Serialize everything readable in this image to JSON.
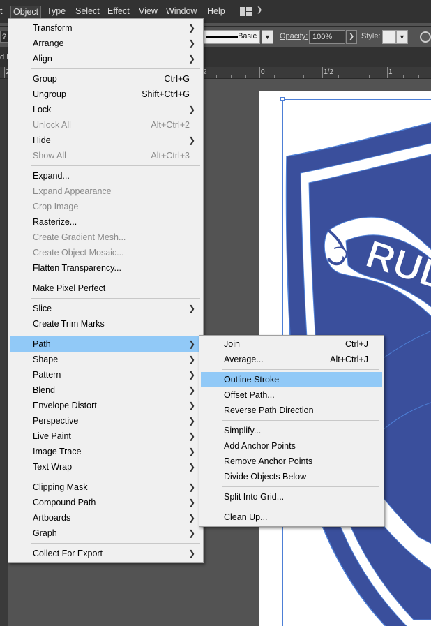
{
  "menubar": {
    "items": [
      {
        "label": "t",
        "active": false
      },
      {
        "label": "Object",
        "active": true
      },
      {
        "label": "Type",
        "active": false
      },
      {
        "label": "Select",
        "active": false
      },
      {
        "label": "Effect",
        "active": false
      },
      {
        "label": "View",
        "active": false
      },
      {
        "label": "Window",
        "active": false
      },
      {
        "label": "Help",
        "active": false
      }
    ],
    "workspace_icon": "workspace-layout-icon"
  },
  "controlbar": {
    "left_glyph": "?",
    "stroke_profile": "Basic",
    "opacity_label": "Opacity:",
    "opacity_value": "100%",
    "style_label": "Style:"
  },
  "tabstrip": {
    "fragment": "d I"
  },
  "ruler": {
    "labels": [
      "2",
      "2",
      "0",
      "1/2",
      "1"
    ]
  },
  "object_menu": {
    "items": [
      {
        "label": "Transform",
        "shortcut": "",
        "submenu": true,
        "disabled": false
      },
      {
        "label": "Arrange",
        "shortcut": "",
        "submenu": true,
        "disabled": false
      },
      {
        "label": "Align",
        "shortcut": "",
        "submenu": true,
        "disabled": false
      },
      {
        "label": "Group",
        "shortcut": "Ctrl+G",
        "submenu": false,
        "disabled": false
      },
      {
        "label": "Ungroup",
        "shortcut": "Shift+Ctrl+G",
        "submenu": false,
        "disabled": false
      },
      {
        "label": "Lock",
        "shortcut": "",
        "submenu": true,
        "disabled": false
      },
      {
        "label": "Unlock All",
        "shortcut": "Alt+Ctrl+2",
        "submenu": false,
        "disabled": true
      },
      {
        "label": "Hide",
        "shortcut": "",
        "submenu": true,
        "disabled": false
      },
      {
        "label": "Show All",
        "shortcut": "Alt+Ctrl+3",
        "submenu": false,
        "disabled": true
      },
      {
        "label": "Expand...",
        "shortcut": "",
        "submenu": false,
        "disabled": false
      },
      {
        "label": "Expand Appearance",
        "shortcut": "",
        "submenu": false,
        "disabled": true
      },
      {
        "label": "Crop Image",
        "shortcut": "",
        "submenu": false,
        "disabled": true
      },
      {
        "label": "Rasterize...",
        "shortcut": "",
        "submenu": false,
        "disabled": false
      },
      {
        "label": "Create Gradient Mesh...",
        "shortcut": "",
        "submenu": false,
        "disabled": true
      },
      {
        "label": "Create Object Mosaic...",
        "shortcut": "",
        "submenu": false,
        "disabled": true
      },
      {
        "label": "Flatten Transparency...",
        "shortcut": "",
        "submenu": false,
        "disabled": false
      },
      {
        "label": "Make Pixel Perfect",
        "shortcut": "",
        "submenu": false,
        "disabled": false
      },
      {
        "label": "Slice",
        "shortcut": "",
        "submenu": true,
        "disabled": false
      },
      {
        "label": "Create Trim Marks",
        "shortcut": "",
        "submenu": false,
        "disabled": false
      },
      {
        "label": "Path",
        "shortcut": "",
        "submenu": true,
        "disabled": false,
        "highlighted": true
      },
      {
        "label": "Shape",
        "shortcut": "",
        "submenu": true,
        "disabled": false
      },
      {
        "label": "Pattern",
        "shortcut": "",
        "submenu": true,
        "disabled": false
      },
      {
        "label": "Blend",
        "shortcut": "",
        "submenu": true,
        "disabled": false
      },
      {
        "label": "Envelope Distort",
        "shortcut": "",
        "submenu": true,
        "disabled": false
      },
      {
        "label": "Perspective",
        "shortcut": "",
        "submenu": true,
        "disabled": false
      },
      {
        "label": "Live Paint",
        "shortcut": "",
        "submenu": true,
        "disabled": false
      },
      {
        "label": "Image Trace",
        "shortcut": "",
        "submenu": true,
        "disabled": false
      },
      {
        "label": "Text Wrap",
        "shortcut": "",
        "submenu": true,
        "disabled": false
      },
      {
        "label": "Clipping Mask",
        "shortcut": "",
        "submenu": true,
        "disabled": false
      },
      {
        "label": "Compound Path",
        "shortcut": "",
        "submenu": true,
        "disabled": false
      },
      {
        "label": "Artboards",
        "shortcut": "",
        "submenu": true,
        "disabled": false
      },
      {
        "label": "Graph",
        "shortcut": "",
        "submenu": true,
        "disabled": false
      },
      {
        "label": "Collect For Export",
        "shortcut": "",
        "submenu": true,
        "disabled": false
      }
    ]
  },
  "path_menu": {
    "items": [
      {
        "label": "Join",
        "shortcut": "Ctrl+J",
        "highlighted": false
      },
      {
        "label": "Average...",
        "shortcut": "Alt+Ctrl+J",
        "highlighted": false
      },
      {
        "label": "Outline Stroke",
        "shortcut": "",
        "highlighted": true
      },
      {
        "label": "Offset Path...",
        "shortcut": "",
        "highlighted": false
      },
      {
        "label": "Reverse Path Direction",
        "shortcut": "",
        "highlighted": false
      },
      {
        "label": "Simplify...",
        "shortcut": "",
        "highlighted": false
      },
      {
        "label": "Add Anchor Points",
        "shortcut": "",
        "highlighted": false
      },
      {
        "label": "Remove Anchor Points",
        "shortcut": "",
        "highlighted": false
      },
      {
        "label": "Divide Objects Below",
        "shortcut": "",
        "highlighted": false
      },
      {
        "label": "Split Into Grid...",
        "shortcut": "",
        "highlighted": false
      },
      {
        "label": "Clean Up...",
        "shortcut": "",
        "highlighted": false
      }
    ]
  },
  "artwork": {
    "banner_text": "RUD",
    "crest_color": "#3a4f9c",
    "outline_color": "#4d7fd6",
    "highlight_color": "#91c9f7"
  }
}
